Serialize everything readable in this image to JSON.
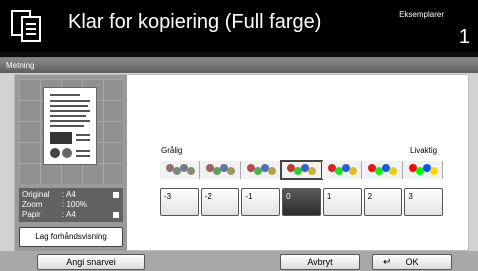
{
  "header": {
    "title": "Klar for kopiering (Full farge)",
    "copies_label": "Eksemplarer",
    "copies_value": "1"
  },
  "panel": {
    "tab_label": "Metning"
  },
  "preview": {
    "original_key": "Original",
    "original_value": ": A4",
    "zoom_key": "Zoom",
    "zoom_value": ": 100%",
    "paper_key": "Papir",
    "paper_value": ": A4",
    "button_label": "Lag forhåndsvisning"
  },
  "saturation": {
    "min_label": "Grålig",
    "max_label": "Livaktig",
    "levels": [
      "-3",
      "-2",
      "-1",
      "0",
      "1",
      "2",
      "3"
    ],
    "selected": "0"
  },
  "bottom": {
    "shortcut_label": "Angi snarvei",
    "cancel_label": "Avbryt",
    "ok_label": "OK"
  }
}
